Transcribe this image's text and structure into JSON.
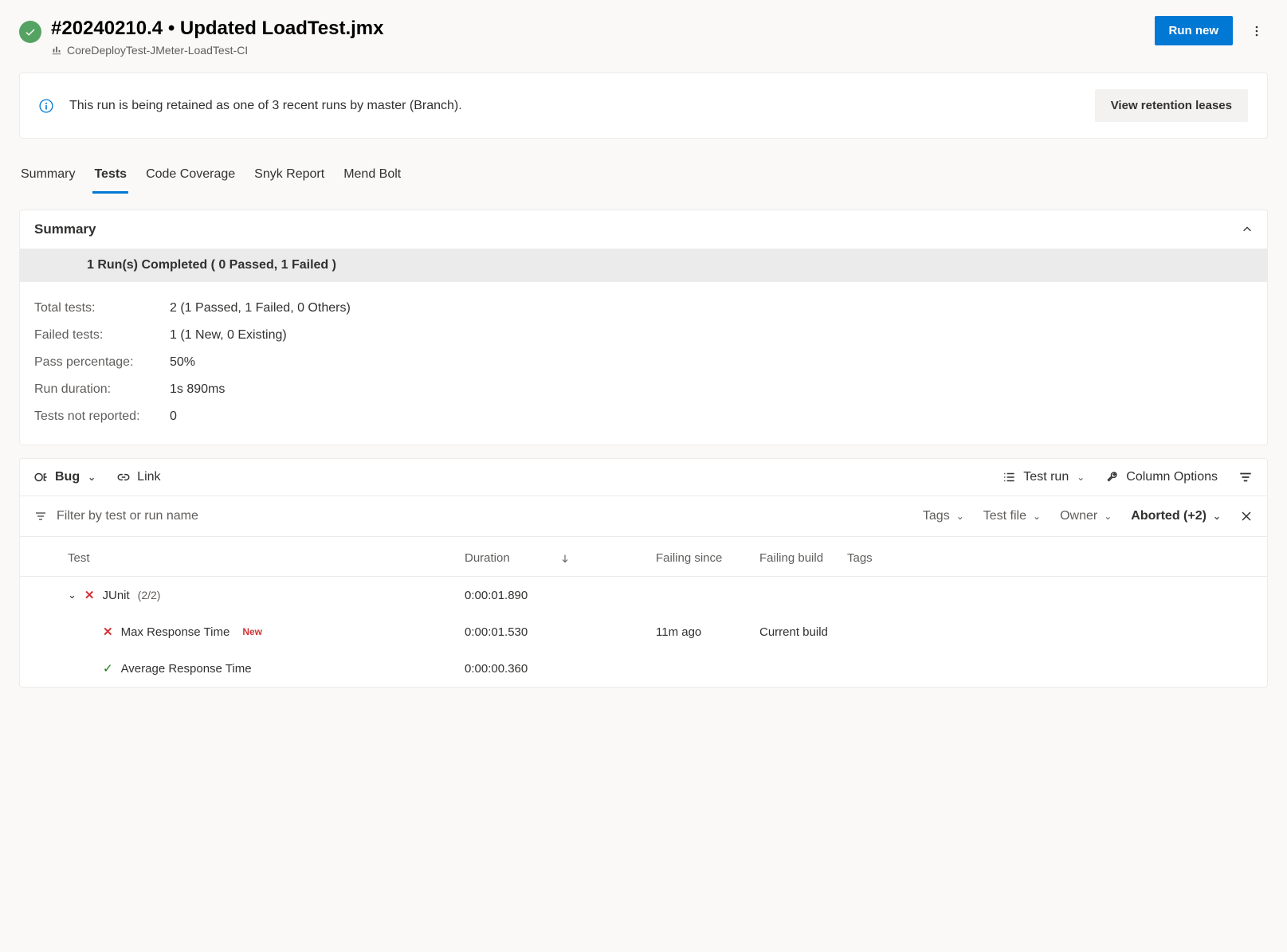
{
  "header": {
    "title": "#20240210.4 • Updated LoadTest.jmx",
    "subtitle": "CoreDeployTest-JMeter-LoadTest-CI",
    "run_new": "Run new"
  },
  "banner": {
    "text": "This run is being retained as one of 3 recent runs by master (Branch).",
    "button": "View retention leases"
  },
  "tabs": [
    "Summary",
    "Tests",
    "Code Coverage",
    "Snyk Report",
    "Mend Bolt"
  ],
  "active_tab": 1,
  "summary": {
    "heading": "Summary",
    "bar": "1 Run(s) Completed ( 0 Passed, 1 Failed )",
    "rows": [
      {
        "label": "Total tests:",
        "value": "2 (1 Passed, 1 Failed, 0 Others)"
      },
      {
        "label": "Failed tests:",
        "value": "1 (1 New, 0 Existing)"
      },
      {
        "label": "Pass percentage:",
        "value": "50%"
      },
      {
        "label": "Run duration:",
        "value": "1s 890ms"
      },
      {
        "label": "Tests not reported:",
        "value": "0"
      }
    ]
  },
  "toolbar": {
    "bug": "Bug",
    "link": "Link",
    "test_run": "Test run",
    "column_options": "Column Options"
  },
  "filter": {
    "placeholder": "Filter by test or run name",
    "tags": "Tags",
    "test_file": "Test file",
    "owner": "Owner",
    "status": "Aborted (+2)"
  },
  "columns": {
    "test": "Test",
    "duration": "Duration",
    "failing_since": "Failing since",
    "failing_build": "Failing build",
    "tags": "Tags"
  },
  "results": {
    "group": {
      "name": "JUnit",
      "count": "(2/2)",
      "duration": "0:00:01.890"
    },
    "rows": [
      {
        "status": "fail",
        "name": "Max Response Time",
        "badge": "New",
        "duration": "0:00:01.530",
        "since": "11m ago",
        "build": "Current build"
      },
      {
        "status": "pass",
        "name": "Average Response Time",
        "badge": "",
        "duration": "0:00:00.360",
        "since": "",
        "build": ""
      }
    ]
  }
}
